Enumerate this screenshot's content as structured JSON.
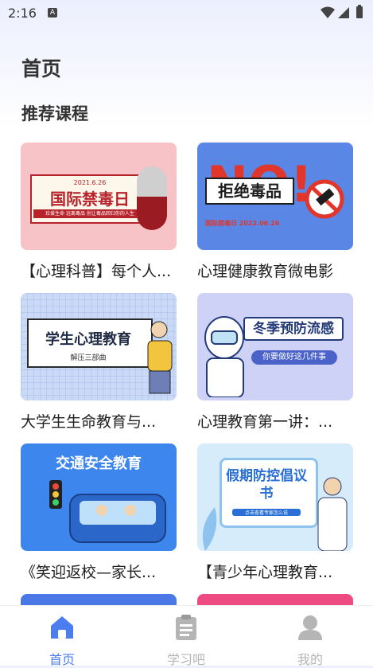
{
  "status": {
    "time": "2:16",
    "a_icon": "A"
  },
  "header": {
    "title": "首页"
  },
  "section": {
    "title": "推荐课程"
  },
  "cards": [
    {
      "title": "【心理科普】每个人...",
      "img_text": "国际禁毒日",
      "img_sub": "珍爱生命 远离毒品 创让毒品回归你的人生",
      "date": "2021.6.26"
    },
    {
      "title": "心理健康教育微电影",
      "img_text": "拒绝毒品",
      "img_big": "NO!",
      "img_sub": "国际禁毒日 2022.06.26"
    },
    {
      "title": "大学生生命教育与...",
      "img_text": "学生心理教育",
      "img_sub": "解压三部曲"
    },
    {
      "title": "心理教育第一讲：...",
      "img_text": "冬季预防流感",
      "img_sub": "你要做好这几件事"
    },
    {
      "title": "《笑迎返校—家长...",
      "img_text": "交通安全教育"
    },
    {
      "title": "【青少年心理教育...",
      "img_text": "假期防控倡议书",
      "img_sub": "点击查看专家怎么说"
    }
  ],
  "nav": [
    {
      "label": "首页",
      "icon": "home-icon"
    },
    {
      "label": "学习吧",
      "icon": "clipboard-icon"
    },
    {
      "label": "我的",
      "icon": "user-icon"
    }
  ],
  "colors": {
    "accent": "#4b7cf0",
    "inactive": "#b5b5b5"
  }
}
